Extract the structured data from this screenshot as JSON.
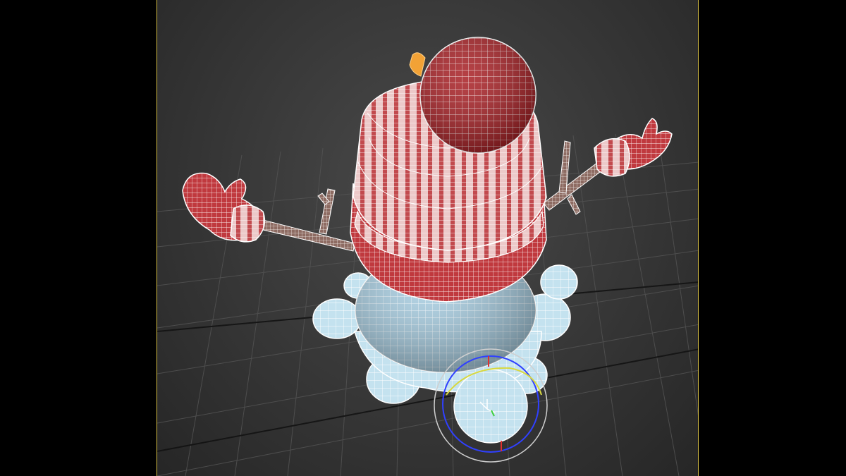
{
  "app": {
    "name": "3d-modeling-viewport",
    "viewport": {
      "label": "",
      "active_border_color": "#d7c047",
      "background_color": "#3a3a3a",
      "grid_color": "#4f4f4f",
      "grid_axis_color": "#0f0f0f"
    },
    "scene": {
      "object": "snowman-model",
      "display_mode": "wireframe-on-shaded",
      "parts": [
        {
          "name": "pompom",
          "color": "#b01f23"
        },
        {
          "name": "knit-hat",
          "color": "#c0383e"
        },
        {
          "name": "hat-cuff",
          "color": "#b62a30"
        },
        {
          "name": "snow-body",
          "color": "#a9cfe3"
        },
        {
          "name": "snow-base",
          "color": "#bfe0ee"
        },
        {
          "name": "stick-arms",
          "color": "#8b6a60"
        },
        {
          "name": "mittens",
          "color": "#c33a42"
        },
        {
          "name": "carrot-nose",
          "color": "#f2a236"
        }
      ]
    },
    "gizmo": {
      "type": "rotate-gizmo",
      "axis_colors": {
        "x": "#e03030",
        "y": "#40d040",
        "z": "#3040ff",
        "view": "#d8d840",
        "outer": "#cfcfcf"
      }
    }
  }
}
